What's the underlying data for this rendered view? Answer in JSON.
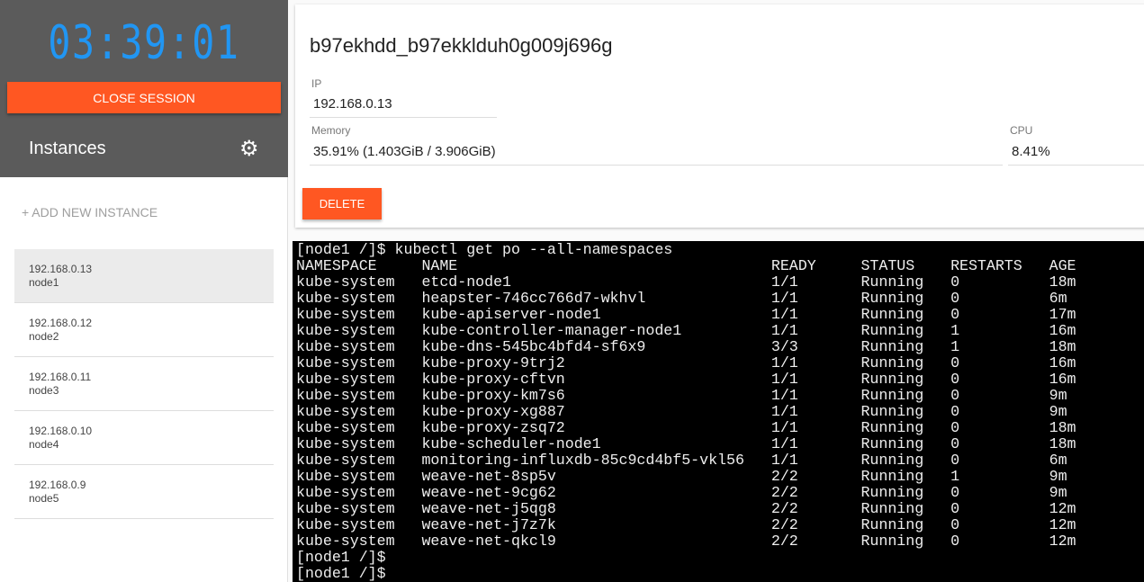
{
  "sidebar": {
    "timer": "03:39:01",
    "close_label": "CLOSE SESSION",
    "instances_title": "Instances",
    "settings_icon": "gear-icon",
    "add_label": "+ ADD NEW INSTANCE",
    "instances": [
      {
        "ip": "192.168.0.13",
        "name": "node1",
        "selected": true
      },
      {
        "ip": "192.168.0.12",
        "name": "node2"
      },
      {
        "ip": "192.168.0.11",
        "name": "node3"
      },
      {
        "ip": "192.168.0.10",
        "name": "node4"
      },
      {
        "ip": "192.168.0.9",
        "name": "node5"
      }
    ]
  },
  "details": {
    "hostname": "b97ekhdd_b97ekklduh0g009j696g",
    "ip_label": "IP",
    "ip": "192.168.0.13",
    "memory_label": "Memory",
    "memory": "35.91% (1.403GiB / 3.906GiB)",
    "cpu_label": "CPU",
    "cpu": "8.41%",
    "delete_label": "DELETE"
  },
  "colors": {
    "accent": "#ff5722",
    "timer": "#2196f3",
    "sidebar_header": "#5b5b5b"
  },
  "terminal": {
    "command": "[node1 /]$ kubectl get po --all-namespaces",
    "headers": [
      "NAMESPACE",
      "NAME",
      "READY",
      "STATUS",
      "RESTARTS",
      "AGE"
    ],
    "rows": [
      [
        "kube-system",
        "etcd-node1",
        "1/1",
        "Running",
        "0",
        "18m"
      ],
      [
        "kube-system",
        "heapster-746cc766d7-wkhvl",
        "1/1",
        "Running",
        "0",
        "6m"
      ],
      [
        "kube-system",
        "kube-apiserver-node1",
        "1/1",
        "Running",
        "0",
        "17m"
      ],
      [
        "kube-system",
        "kube-controller-manager-node1",
        "1/1",
        "Running",
        "1",
        "16m"
      ],
      [
        "kube-system",
        "kube-dns-545bc4bfd4-sf6x9",
        "3/3",
        "Running",
        "1",
        "18m"
      ],
      [
        "kube-system",
        "kube-proxy-9trj2",
        "1/1",
        "Running",
        "0",
        "16m"
      ],
      [
        "kube-system",
        "kube-proxy-cftvn",
        "1/1",
        "Running",
        "0",
        "16m"
      ],
      [
        "kube-system",
        "kube-proxy-km7s6",
        "1/1",
        "Running",
        "0",
        "9m"
      ],
      [
        "kube-system",
        "kube-proxy-xg887",
        "1/1",
        "Running",
        "0",
        "9m"
      ],
      [
        "kube-system",
        "kube-proxy-zsq72",
        "1/1",
        "Running",
        "0",
        "18m"
      ],
      [
        "kube-system",
        "kube-scheduler-node1",
        "1/1",
        "Running",
        "0",
        "18m"
      ],
      [
        "kube-system",
        "monitoring-influxdb-85c9cd4bf5-vkl56",
        "1/1",
        "Running",
        "0",
        "6m"
      ],
      [
        "kube-system",
        "weave-net-8sp5v",
        "2/2",
        "Running",
        "1",
        "9m"
      ],
      [
        "kube-system",
        "weave-net-9cg62",
        "2/2",
        "Running",
        "0",
        "9m"
      ],
      [
        "kube-system",
        "weave-net-j5qg8",
        "2/2",
        "Running",
        "0",
        "12m"
      ],
      [
        "kube-system",
        "weave-net-j7z7k",
        "2/2",
        "Running",
        "0",
        "12m"
      ],
      [
        "kube-system",
        "weave-net-qkcl9",
        "2/2",
        "Running",
        "0",
        "12m"
      ]
    ],
    "prompts": [
      "[node1 /]$",
      "[node1 /]$"
    ]
  }
}
